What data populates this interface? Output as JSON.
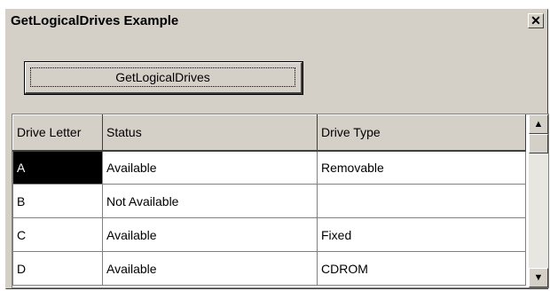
{
  "window": {
    "title": "GetLogicalDrives Example",
    "close_glyph": "✕"
  },
  "toolbar": {
    "button_label": "GetLogicalDrives"
  },
  "grid": {
    "headers": [
      "Drive Letter",
      "Status",
      "Drive Type"
    ],
    "rows": [
      [
        "A",
        "Available",
        "Removable"
      ],
      [
        "B",
        "Not Available",
        ""
      ],
      [
        "C",
        "Available",
        "Fixed"
      ],
      [
        "D",
        "Available",
        "CDROM"
      ]
    ]
  },
  "scroll": {
    "up_glyph": "▲",
    "down_glyph": "▼"
  }
}
